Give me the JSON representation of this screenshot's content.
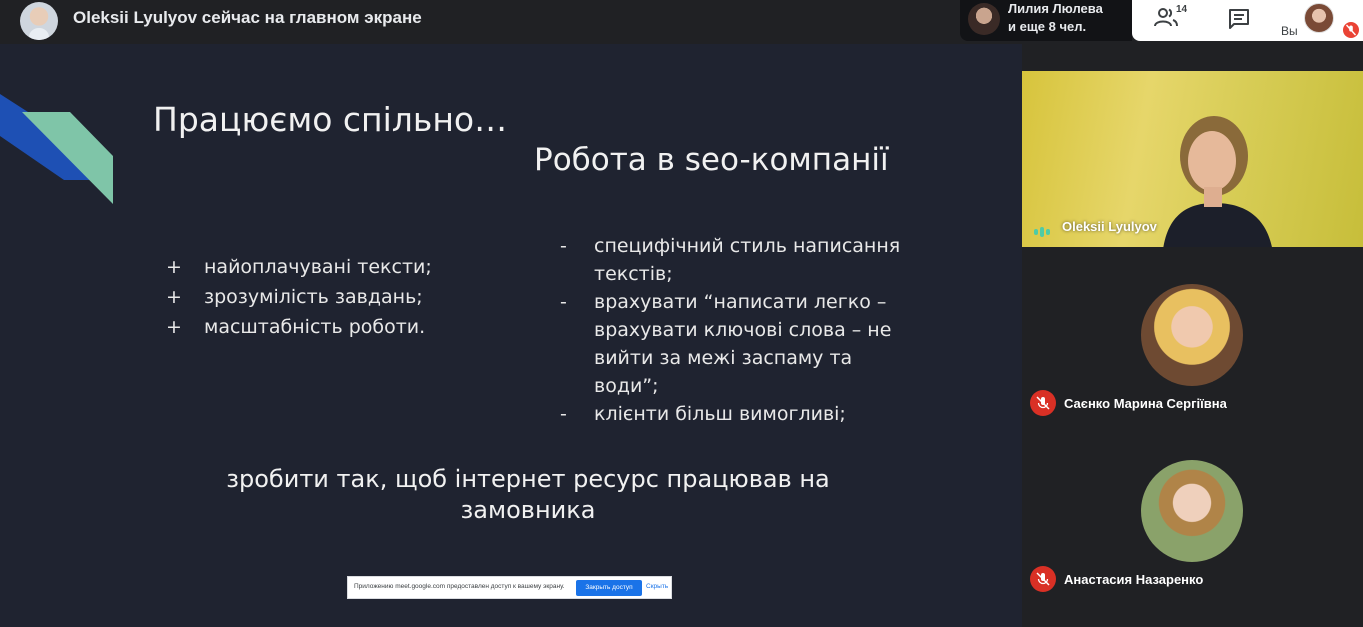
{
  "topbar": {
    "presenting_text": "Oleksii Lyulyov сейчас на главном экране",
    "viewers_line1": "Лилия Люлева",
    "viewers_line2": "и еще 8 чел.",
    "people_count": "14",
    "self_label": "Вы"
  },
  "slide": {
    "title": "Працюємо спільно…",
    "subtitle": "Робота в seo-компанії",
    "plus_items": [
      {
        "bullet": "+",
        "text": "найоплачувані тексти;"
      },
      {
        "bullet": "+",
        "text": "зрозумілість завдань;"
      },
      {
        "bullet": "+",
        "text": "масштабність роботи."
      }
    ],
    "minus_items": [
      {
        "bullet": "-",
        "text": "специфічний стиль написання текстів;"
      },
      {
        "bullet": "-",
        "text": "врахувати “написати легко – врахувати ключові слова – не вийти за межі заспаму та води”;"
      },
      {
        "bullet": "-",
        "text": "клієнти більш вимогливі;"
      }
    ],
    "conclusion": "зробити так, щоб інтернет ресурс працював на замовника"
  },
  "share_bar": {
    "text": "Приложению meet.google.com предоставлен доступ к вашему экрану.",
    "stop_label": "Закрыть доступ",
    "hide_label": "Скрыть"
  },
  "participants": {
    "main_name": "Oleksii Lyulyov",
    "p1_name": "Саєнко Марина Сергіївна",
    "p2_name": "Анастасия Назаренко"
  },
  "colors": {
    "slide_bg": "#1f2330",
    "accent_blue": "#1e50b4",
    "accent_mint": "#7fc5a8",
    "mic_off_red": "#d93025",
    "share_button": "#1a73e8"
  },
  "icons": [
    "people-icon",
    "chat-icon",
    "mic-off-icon",
    "speaking-indicator-icon"
  ]
}
